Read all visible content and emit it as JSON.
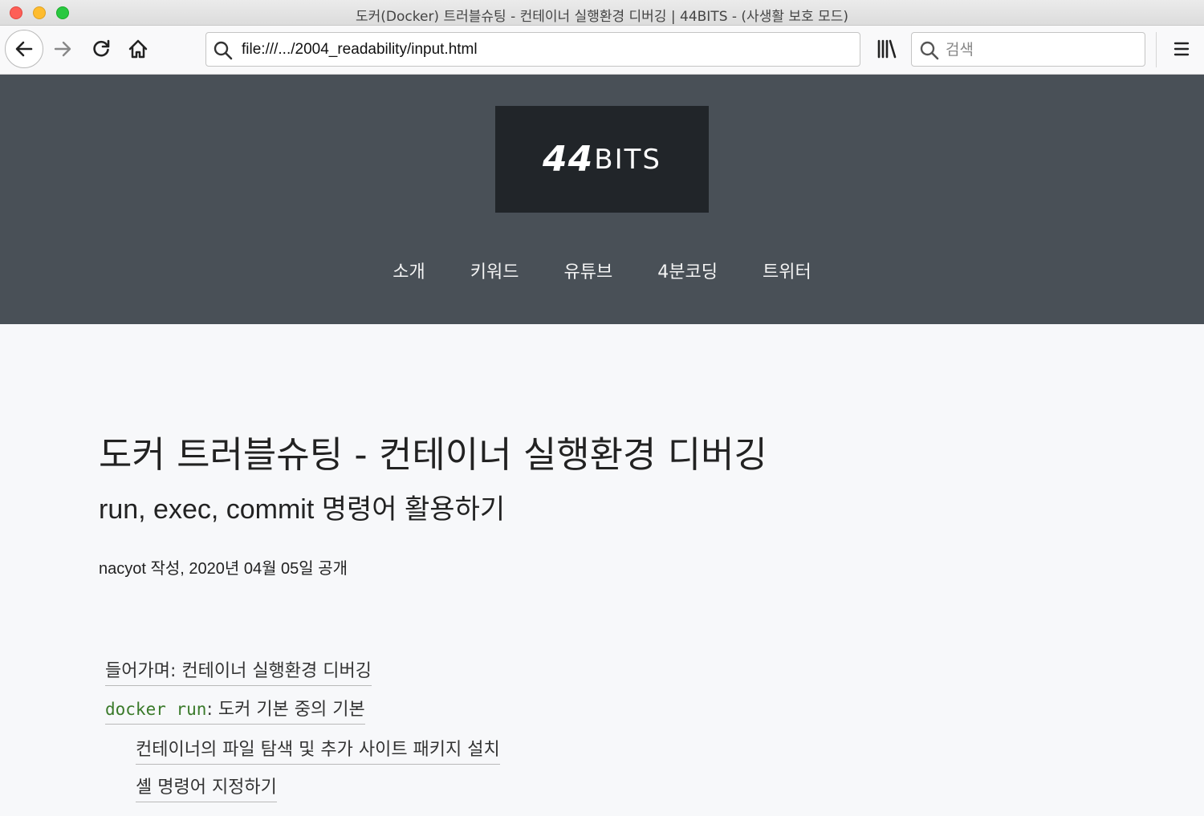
{
  "window": {
    "title": "도커(Docker) 트러블슈팅 - 컨테이너 실행환경 디버깅 | 44BITS - (사생활 보호 모드)"
  },
  "toolbar": {
    "url": "file:///.../2004_readability/input.html",
    "search_placeholder": "검색"
  },
  "site": {
    "logo_number": "44",
    "logo_word": "BITS",
    "nav": [
      {
        "label": "소개"
      },
      {
        "label": "키워드"
      },
      {
        "label": "유튜브"
      },
      {
        "label": "4분코딩"
      },
      {
        "label": "트위터"
      }
    ]
  },
  "post": {
    "title": "도커 트러블슈팅 - 컨테이너 실행환경 디버깅",
    "subtitle": "run, exec, commit 명령어 활용하기",
    "meta": "nacyot 작성, 2020년 04월 05일 공개"
  },
  "toc": {
    "item1": "들어가며: 컨테이너 실행환경 디버깅",
    "item2_code": "docker run",
    "item2_rest": ": 도커 기본 중의 기본",
    "item3": "컨테이너의 파일 탐색 및 추가 사이트 패키지 설치",
    "item4": "셸 명령어 지정하기"
  }
}
